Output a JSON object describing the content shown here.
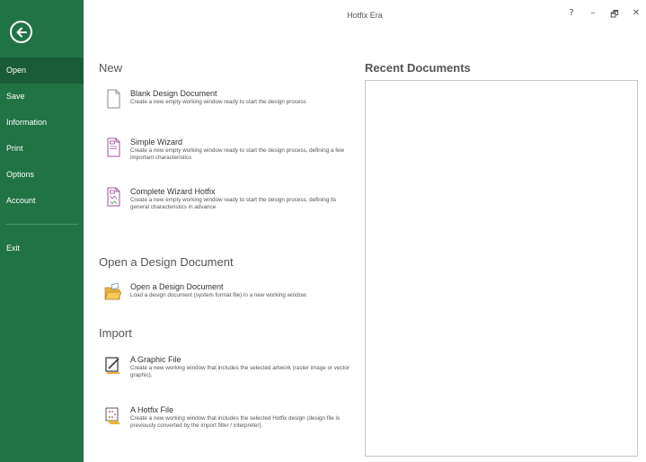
{
  "window": {
    "title": "Hotfix Era",
    "controls": {
      "help": "?",
      "minimize": "–",
      "restore": "🗗",
      "close": "✕"
    }
  },
  "sidebar": {
    "back_icon": "arrow-left-circle-icon",
    "items": [
      {
        "label": "Open",
        "active": true
      },
      {
        "label": "Save",
        "active": false
      },
      {
        "label": "Information",
        "active": false
      },
      {
        "label": "Print",
        "active": false
      },
      {
        "label": "Options",
        "active": false
      },
      {
        "label": "Account",
        "active": false
      },
      {
        "label": "Exit",
        "active": false
      }
    ]
  },
  "new_section": {
    "heading": "New",
    "items": [
      {
        "title": "Blank Design Document",
        "desc": "Create a new empty working window ready to start the design process",
        "icon": "blank-document-icon"
      },
      {
        "title": "Simple Wizard",
        "desc": "Create a new empty working window ready to start the design process, defining a few important characteristics",
        "icon": "wizard-document-icon"
      },
      {
        "title": "Complete Wizard Hotfix",
        "desc": "Create a new empty working window ready to start the design process, defining its general characteristics in advance",
        "icon": "complete-wizard-icon"
      }
    ]
  },
  "open_section": {
    "heading": "Open a Design Document",
    "items": [
      {
        "title": "Open a Design Document",
        "desc": "Load a design document (system format file) in a new working window.",
        "icon": "open-folder-icon"
      }
    ]
  },
  "import_section": {
    "heading": "Import",
    "items": [
      {
        "title": "A Graphic File",
        "desc": "Create a new working window that includes the selected artwork (raster image or vector graphic).",
        "icon": "graphic-file-icon"
      },
      {
        "title": "A Hotfix File",
        "desc": "Create a new working window that includes the selected Hotfix design (design file is previously converted by the import filter / interpreter).",
        "icon": "hotfix-file-icon"
      }
    ]
  },
  "recent": {
    "heading": "Recent Documents"
  },
  "colors": {
    "sidebar": "#217346",
    "sidebar_active": "#1a5c38"
  }
}
